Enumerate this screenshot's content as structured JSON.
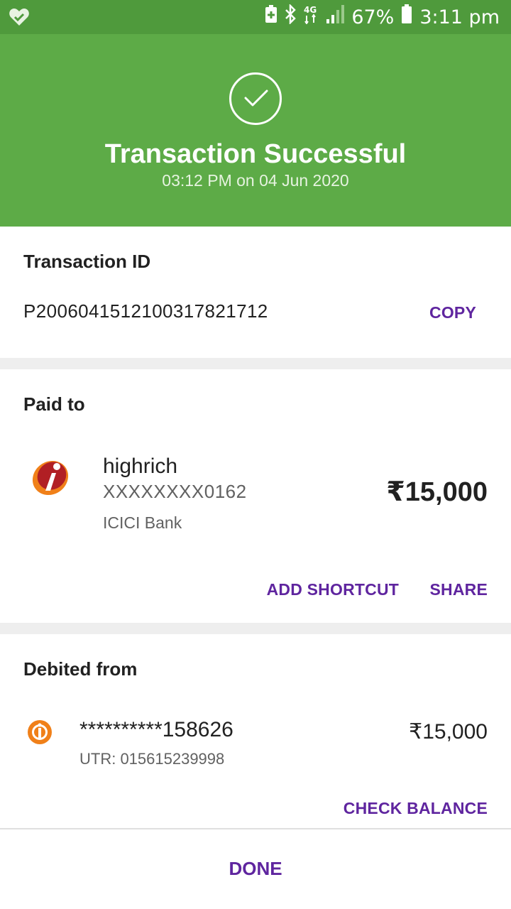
{
  "status_bar": {
    "battery_percent": "67%",
    "time": "3:11 pm",
    "network": "4G",
    "icons": [
      "heart-check-icon",
      "battery-saver-icon",
      "bluetooth-icon",
      "network-4g-icon",
      "signal-icon",
      "battery-icon"
    ]
  },
  "header": {
    "title": "Transaction Successful",
    "subtitle": "03:12 PM on 04 Jun 2020",
    "icon": "check-circle-icon",
    "background": "#5dab47"
  },
  "transaction": {
    "label": "Transaction ID",
    "id": "P2006041512100317821712",
    "copy_label": "COPY"
  },
  "paid_to": {
    "label": "Paid to",
    "name": "highrich",
    "account": "XXXXXXXX0162",
    "bank": "ICICI Bank",
    "amount": "₹15,000",
    "add_shortcut_label": "ADD SHORTCUT",
    "share_label": "SHARE",
    "logo_icon": "icici-bank-logo-icon"
  },
  "debited_from": {
    "label": "Debited from",
    "account": "**********158626",
    "utr": "UTR: 015615239998",
    "amount": "₹15,000",
    "check_balance_label": "CHECK BALANCE",
    "logo_icon": "bank-logo-icon"
  },
  "footer": {
    "done_label": "DONE"
  },
  "colors": {
    "accent": "#5f259f",
    "status_bar": "#4f9a3c",
    "success": "#5dab47"
  }
}
